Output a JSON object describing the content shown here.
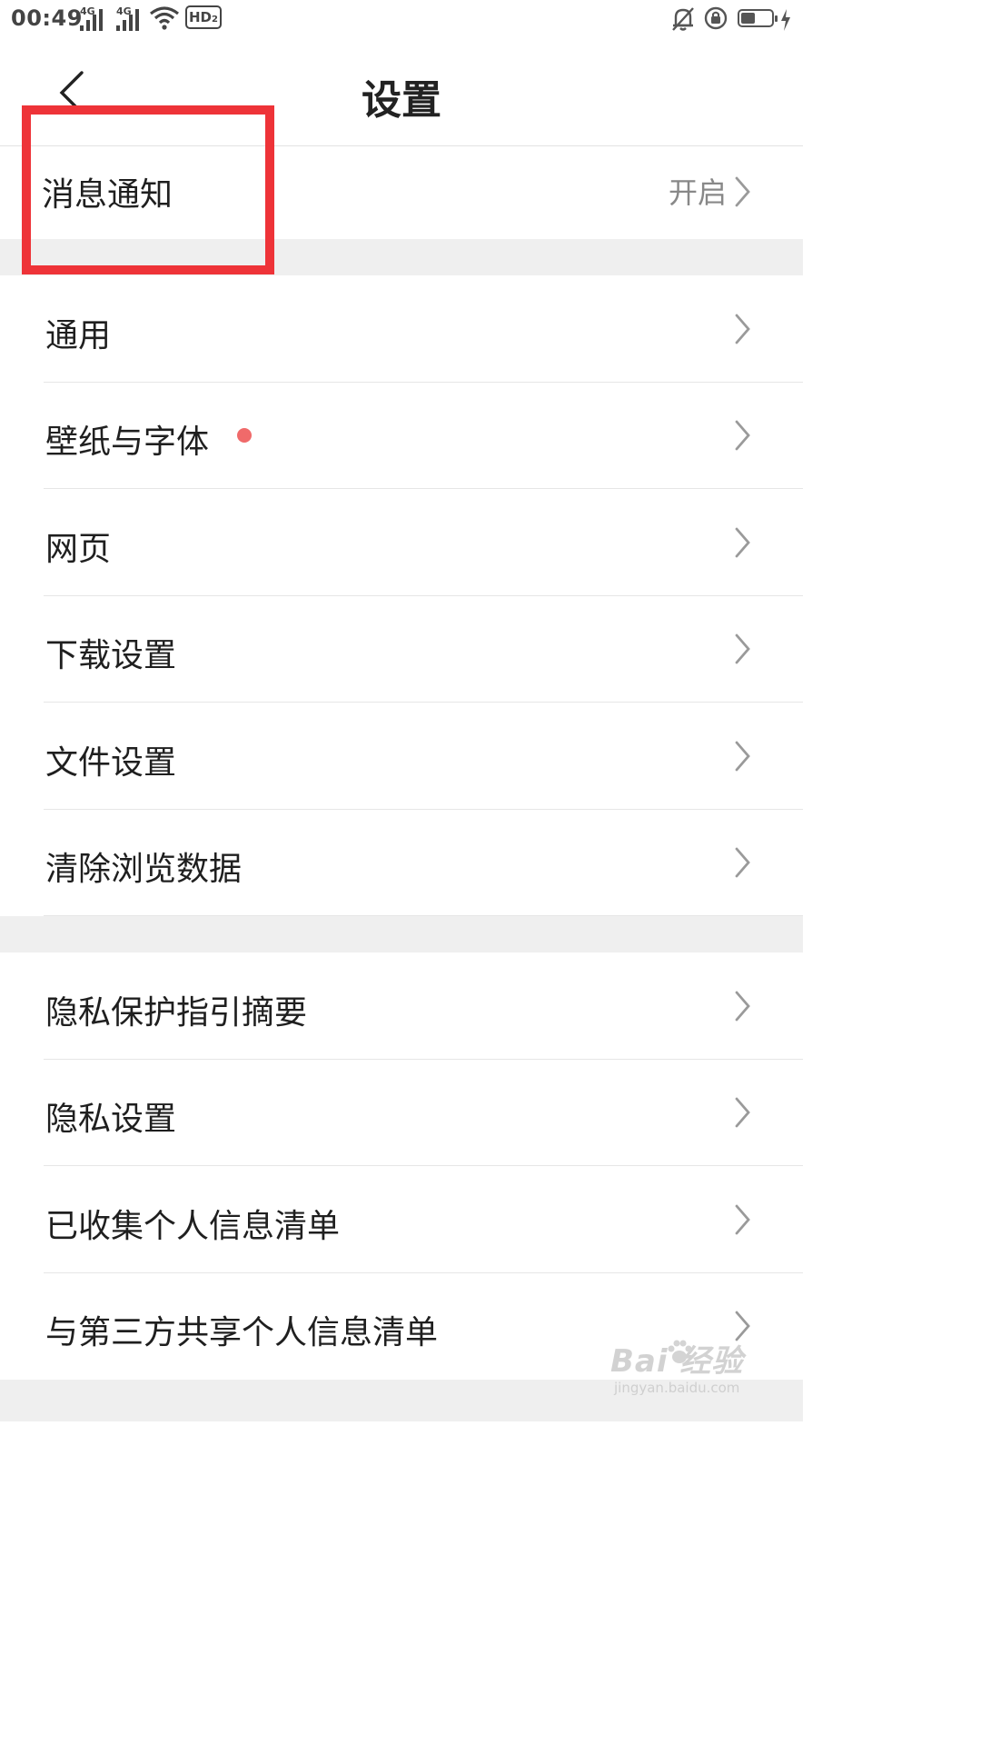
{
  "status_bar": {
    "time": "00:49",
    "signal1_label": "4G",
    "signal2_label": "4G",
    "hd_label": "HD",
    "hd_sub": "2",
    "battery_level": 0.46
  },
  "header": {
    "title": "设置"
  },
  "notification_row": {
    "label": "消息通知",
    "value": "开启"
  },
  "section_general": {
    "items": [
      {
        "label": "通用"
      },
      {
        "label": "壁纸与字体",
        "has_dot": true
      },
      {
        "label": "网页"
      },
      {
        "label": "下载设置"
      },
      {
        "label": "文件设置"
      },
      {
        "label": "清除浏览数据"
      }
    ]
  },
  "section_privacy": {
    "items": [
      {
        "label": "隐私保护指引摘要"
      },
      {
        "label": "隐私设置"
      },
      {
        "label": "已收集个人信息清单"
      },
      {
        "label": "与第三方共享个人信息清单"
      }
    ]
  },
  "watermark": {
    "main": "Bai 经验",
    "sub": "jingyan.baidu.com"
  },
  "colors": {
    "highlight": "#ee3338",
    "red_dot": "#f06a6a",
    "section_gap": "#efefef"
  }
}
